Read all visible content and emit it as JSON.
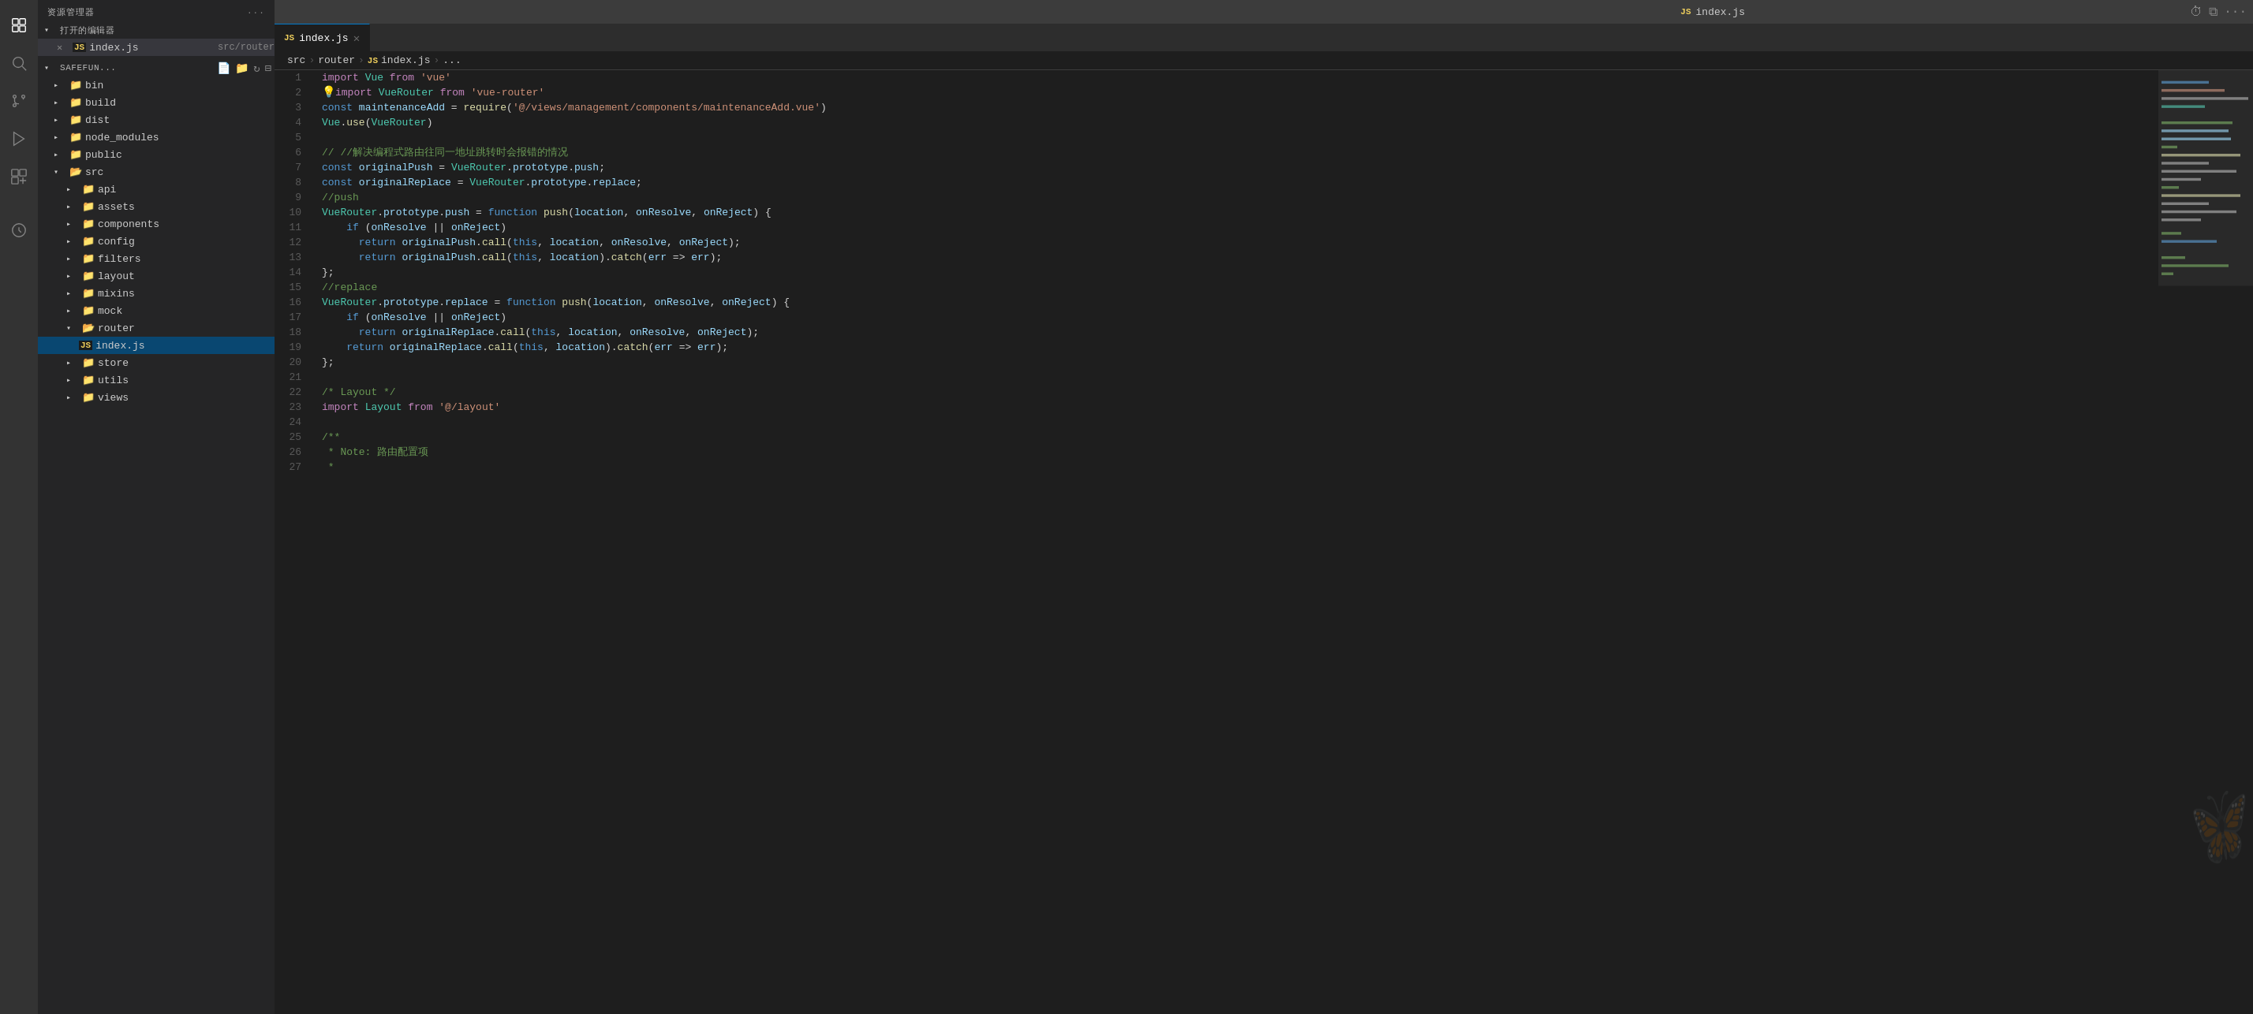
{
  "titleBar": {
    "fileName": "index.js",
    "jsBadge": "JS",
    "actions": [
      "history-icon",
      "split-editor-icon",
      "more-icon"
    ]
  },
  "sidebar": {
    "header": "资源管理器",
    "openEditors": {
      "label": "打开的编辑器",
      "files": [
        {
          "name": "index.js",
          "path": "src/router",
          "badge": "JS",
          "active": true,
          "modified": false
        }
      ]
    },
    "project": {
      "label": "SAFEFUN...",
      "actions": [
        "new-file-icon",
        "new-folder-icon",
        "refresh-icon",
        "collapse-icon"
      ],
      "tree": [
        {
          "type": "folder",
          "name": "bin",
          "depth": 1,
          "open": false
        },
        {
          "type": "folder",
          "name": "build",
          "depth": 1,
          "open": false
        },
        {
          "type": "folder",
          "name": "dist",
          "depth": 1,
          "open": false
        },
        {
          "type": "folder",
          "name": "node_modules",
          "depth": 1,
          "open": false
        },
        {
          "type": "folder",
          "name": "public",
          "depth": 1,
          "open": false
        },
        {
          "type": "folder",
          "name": "src",
          "depth": 1,
          "open": true
        },
        {
          "type": "folder",
          "name": "api",
          "depth": 2,
          "open": false
        },
        {
          "type": "folder",
          "name": "assets",
          "depth": 2,
          "open": false
        },
        {
          "type": "folder",
          "name": "components",
          "depth": 2,
          "open": false
        },
        {
          "type": "folder",
          "name": "config",
          "depth": 2,
          "open": false
        },
        {
          "type": "folder",
          "name": "filters",
          "depth": 2,
          "open": false
        },
        {
          "type": "folder",
          "name": "layout",
          "depth": 2,
          "open": false
        },
        {
          "type": "folder",
          "name": "mixins",
          "depth": 2,
          "open": false
        },
        {
          "type": "folder",
          "name": "mock",
          "depth": 2,
          "open": false
        },
        {
          "type": "folder",
          "name": "router",
          "depth": 2,
          "open": true
        },
        {
          "type": "file",
          "name": "index.js",
          "depth": 3,
          "badge": "JS",
          "active": true
        },
        {
          "type": "folder",
          "name": "store",
          "depth": 2,
          "open": false
        },
        {
          "type": "folder",
          "name": "utils",
          "depth": 2,
          "open": false
        },
        {
          "type": "folder",
          "name": "views",
          "depth": 2,
          "open": false
        }
      ]
    }
  },
  "breadcrumb": {
    "items": [
      "src",
      "router",
      "JS index.js",
      "..."
    ]
  },
  "editor": {
    "lines": [
      {
        "num": 1,
        "content": "import_vue"
      },
      {
        "num": 2,
        "content": "import_vuerouter"
      },
      {
        "num": 3,
        "content": "const_maintenance"
      },
      {
        "num": 4,
        "content": "vue_use"
      },
      {
        "num": 5,
        "content": ""
      },
      {
        "num": 6,
        "content": "comment_resolve"
      },
      {
        "num": 7,
        "content": "const_originalpush"
      },
      {
        "num": 8,
        "content": "const_originalreplace"
      },
      {
        "num": 9,
        "content": "comment_push"
      },
      {
        "num": 10,
        "content": "vuerouter_push"
      },
      {
        "num": 11,
        "content": "if_onresolve"
      },
      {
        "num": 12,
        "content": "return_originalpush_call"
      },
      {
        "num": 13,
        "content": "return_originalpush_catch"
      },
      {
        "num": 14,
        "content": "close_brace"
      },
      {
        "num": 15,
        "content": "comment_replace"
      },
      {
        "num": 16,
        "content": "vuerouter_replace"
      },
      {
        "num": 17,
        "content": "if_onresolve2"
      },
      {
        "num": 18,
        "content": "return_originalreplace_call"
      },
      {
        "num": 19,
        "content": "return_originalreplace_catch"
      },
      {
        "num": 20,
        "content": "close_brace2"
      },
      {
        "num": 21,
        "content": ""
      },
      {
        "num": 22,
        "content": "comment_layout"
      },
      {
        "num": 23,
        "content": "import_layout"
      },
      {
        "num": 24,
        "content": ""
      },
      {
        "num": 25,
        "content": "jsdoc_start"
      },
      {
        "num": 26,
        "content": "jsdoc_note"
      },
      {
        "num": 27,
        "content": "jsdoc_star"
      }
    ]
  }
}
